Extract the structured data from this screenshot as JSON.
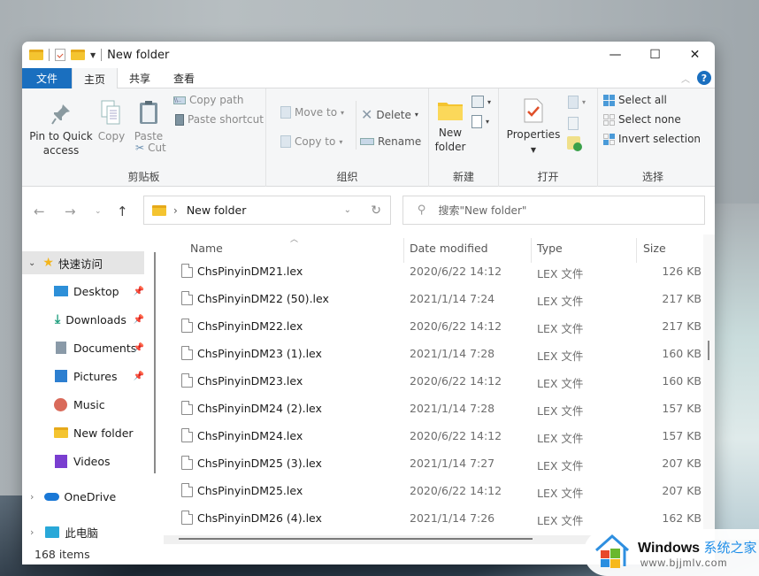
{
  "window": {
    "title": "New folder"
  },
  "title_bar": {
    "minimize_icon": "—",
    "maximize_icon": "☐",
    "close_icon": "✕"
  },
  "ribbon_tabs": [
    {
      "label": "文件",
      "kind": "file"
    },
    {
      "label": "主页",
      "active": true
    },
    {
      "label": "共享"
    },
    {
      "label": "查看"
    }
  ],
  "ribbon": {
    "clipboard": {
      "label": "剪贴板",
      "pin_to_quick_access": "Pin to Quick access",
      "pin_line1": "Pin to Quick",
      "pin_line2": "access",
      "copy": "Copy",
      "paste": "Paste",
      "cut": "Cut",
      "copy_path": "Copy path",
      "paste_shortcut": "Paste shortcut"
    },
    "organize": {
      "label": "组织",
      "move_to": "Move to",
      "copy_to": "Copy to",
      "delete": "Delete",
      "rename": "Rename"
    },
    "new": {
      "label": "新建",
      "new_folder_line1": "New",
      "new_folder_line2": "folder"
    },
    "open": {
      "label": "打开",
      "properties": "Properties"
    },
    "select": {
      "label": "选择",
      "select_all": "Select all",
      "select_none": "Select none",
      "invert_selection": "Invert selection"
    }
  },
  "nav": {
    "breadcrumb_sep": "›",
    "address": "New folder",
    "search_placeholder": "搜索\"New folder\""
  },
  "sidebar": {
    "quick_access": "快速访问",
    "items": [
      {
        "label": "Desktop",
        "pinned": true
      },
      {
        "label": "Downloads",
        "pinned": true
      },
      {
        "label": "Documents",
        "pinned": true
      },
      {
        "label": "Pictures",
        "pinned": true
      },
      {
        "label": "Music",
        "pinned": false
      },
      {
        "label": "New folder",
        "pinned": false
      },
      {
        "label": "Videos",
        "pinned": false
      }
    ],
    "onedrive": "OneDrive",
    "this_pc": "此电脑"
  },
  "columns": {
    "name": "Name",
    "date": "Date modified",
    "type": "Type",
    "size": "Size"
  },
  "files": [
    {
      "name": "ChsPinyinDM21.lex",
      "date": "2020/6/22 14:12",
      "type": "LEX 文件",
      "size": "126 KB"
    },
    {
      "name": "ChsPinyinDM22 (50).lex",
      "date": "2021/1/14 7:24",
      "type": "LEX 文件",
      "size": "217 KB"
    },
    {
      "name": "ChsPinyinDM22.lex",
      "date": "2020/6/22 14:12",
      "type": "LEX 文件",
      "size": "217 KB"
    },
    {
      "name": "ChsPinyinDM23 (1).lex",
      "date": "2021/1/14 7:28",
      "type": "LEX 文件",
      "size": "160 KB"
    },
    {
      "name": "ChsPinyinDM23.lex",
      "date": "2020/6/22 14:12",
      "type": "LEX 文件",
      "size": "160 KB"
    },
    {
      "name": "ChsPinyinDM24 (2).lex",
      "date": "2021/1/14 7:28",
      "type": "LEX 文件",
      "size": "157 KB"
    },
    {
      "name": "ChsPinyinDM24.lex",
      "date": "2020/6/22 14:12",
      "type": "LEX 文件",
      "size": "157 KB"
    },
    {
      "name": "ChsPinyinDM25 (3).lex",
      "date": "2021/1/14 7:27",
      "type": "LEX 文件",
      "size": "207 KB"
    },
    {
      "name": "ChsPinyinDM25.lex",
      "date": "2020/6/22 14:12",
      "type": "LEX 文件",
      "size": "207 KB"
    },
    {
      "name": "ChsPinyinDM26 (4).lex",
      "date": "2021/1/14 7:26",
      "type": "LEX 文件",
      "size": "162 KB"
    }
  ],
  "status": {
    "item_count": "168 items"
  },
  "watermark": {
    "brand": "Windows",
    "brand_cn": "系统之家",
    "url": "www.bjjmlv.com"
  },
  "colors": {
    "accent": "#1a6fbf",
    "folder": "#f4c430"
  }
}
